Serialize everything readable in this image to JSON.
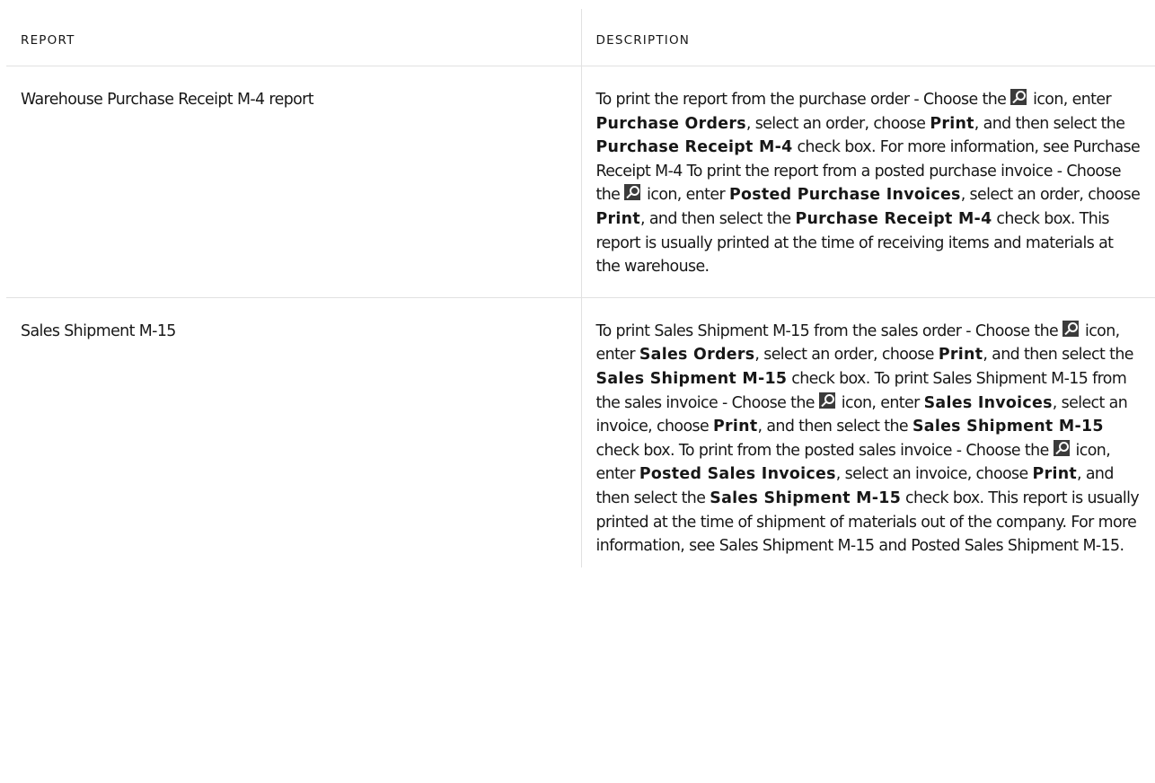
{
  "table": {
    "headers": {
      "report": "REPORT",
      "description": "DESCRIPTION"
    },
    "rows": [
      {
        "report": "Warehouse Purchase Receipt M-4 report",
        "description": {
          "p1": "To print the report from the purchase order - Choose the",
          "p2": "icon, enter",
          "ui1": "Purchase Orders",
          "p3": ", select an order, choose",
          "ui2": "Print",
          "p4": ", and then select the",
          "ui3": "Purchase Receipt M-4",
          "p5": "check box. For more information, see Purchase Receipt M-4 To print the report from a posted purchase invoice - Choose the",
          "p6": "icon, enter",
          "ui4": "Posted Purchase Invoices",
          "p7": ", select an order, choose",
          "ui5": "Print",
          "p8": ", and then select the",
          "ui6": "Purchase Receipt M-4",
          "p9": "check box. This report is usually printed at the time of receiving items and materials at the warehouse."
        }
      },
      {
        "report": "Sales Shipment M-15",
        "description": {
          "p1": "To print Sales Shipment M-15 from the sales order - Choose the",
          "p2": "icon, enter",
          "ui1": "Sales Orders",
          "p3": ", select an order, choose",
          "ui2": "Print",
          "p4": ", and then select the",
          "ui3": "Sales Shipment M-15",
          "p5": "check box. To print Sales Shipment M-15 from the sales invoice - Choose the",
          "p6": "icon, enter",
          "ui4": "Sales Invoices",
          "p7": ", select an invoice, choose",
          "ui5": "Print",
          "p8": ", and then select the",
          "ui6": "Sales Shipment M-15",
          "p9": "check box. To print from the posted sales invoice - Choose the",
          "p10": "icon, enter",
          "ui7": "Posted Sales Invoices",
          "p11": ", select an invoice, choose",
          "ui8": "Print",
          "p12": ", and then select the",
          "ui9": "Sales Shipment M-15",
          "p13": "check box. This report is usually printed at the time of shipment of materials out of the company. For more information, see Sales Shipment M-15 and Posted Sales Shipment M-15."
        }
      }
    ]
  },
  "icons": {
    "search": "search-icon"
  },
  "colors": {
    "text": "#171717",
    "border": "#e1e1e1",
    "icon_bg": "#3b3b3b"
  }
}
